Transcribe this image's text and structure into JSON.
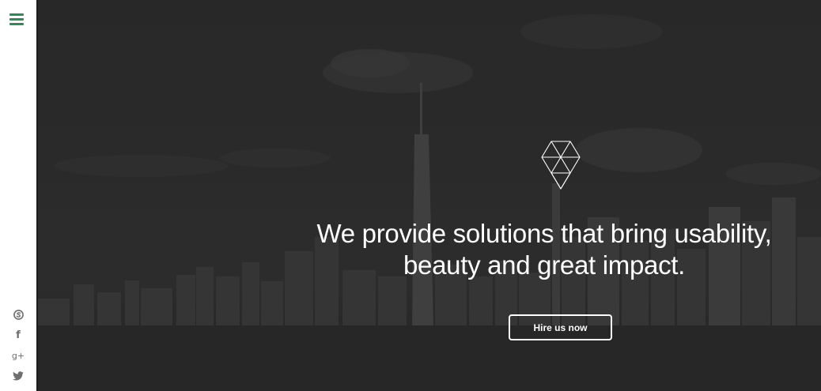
{
  "sidebar": {
    "menu_icon": "hamburger-menu-icon",
    "social_icons": [
      "skype-icon",
      "facebook-icon",
      "google-plus-icon",
      "twitter-icon"
    ],
    "social_glyphs": {
      "facebook": "f",
      "google_plus": "g+"
    }
  },
  "hero": {
    "logo_icon": "geometric-diamond-logo",
    "headline_line1": "We provide solutions that bring usability,",
    "headline_line2": "beauty and great impact.",
    "cta_label": "Hire us now"
  },
  "colors": {
    "accent": "#2e8b57",
    "sidebar_icon": "#6e6e6e",
    "hero_overlay": "#2c2c2c",
    "text": "#ffffff"
  }
}
